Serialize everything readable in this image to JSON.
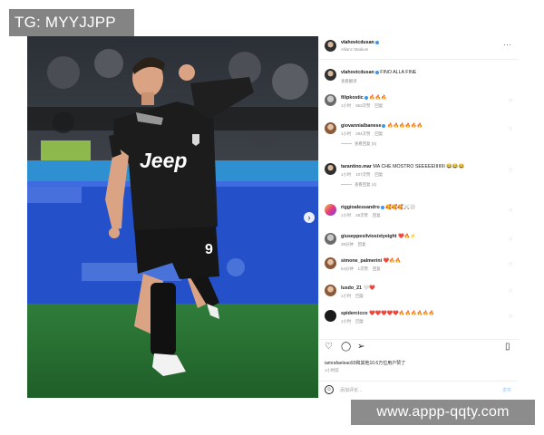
{
  "watermarks": {
    "top": "TG: MYYJJPP",
    "bottom": "www.appp-qqty.com"
  },
  "post": {
    "author": "vlahovicdusan",
    "location": "Allianz Stadium",
    "menu_icon": "more-horizontal-icon",
    "caption": "FINO ALLA FINE",
    "caption_translate": "查看翻译",
    "photo": {
      "shirt_sponsor": "Jeep",
      "shirt_number": "9",
      "next_icon": "chevron-right-icon",
      "tag_icon": "user-tag-icon",
      "slide_count": 5,
      "current_slide": 1
    }
  },
  "comments": [
    {
      "user": "filipkostic",
      "verified": true,
      "text": "🔥🔥🔥",
      "time": "1小时",
      "likes": "653次赞",
      "reply": "回复",
      "thread": ""
    },
    {
      "user": "giovannialbanese",
      "verified": true,
      "text": "🔥🔥🔥🔥🔥🔥",
      "time": "1小时",
      "likes": "284次赞",
      "reply": "回复",
      "thread": "查看回复 (5)"
    },
    {
      "user": "tarantino.mar",
      "verified": false,
      "text": "MA CHE MOSTRO SEEEEEIIIIIIII 😂😂😂",
      "time": "1小时",
      "likes": "107次赞",
      "reply": "回复",
      "thread": "查看回复 (4)"
    },
    {
      "user": "riggioalessandro",
      "verified": true,
      "text": "🥰🥰🥰⚔️⚪",
      "time": "1小时",
      "likes": "28次赞",
      "reply": "回复",
      "thread": ""
    },
    {
      "user": "giuseppesilviosixtyeight",
      "verified": false,
      "text": "❤️🔥⚡",
      "time": "39分钟",
      "likes": "",
      "reply": "回复",
      "thread": ""
    },
    {
      "user": "simone_palmerini",
      "verified": false,
      "text": "❤️🔥🔥",
      "time": "54分钟",
      "likes": "1次赞",
      "reply": "回复",
      "thread": ""
    },
    {
      "user": "lusdo_21",
      "verified": false,
      "text": "🤍❤️",
      "time": "1小时",
      "likes": "",
      "reply": "回复",
      "thread": ""
    },
    {
      "user": "spidercicco",
      "verified": false,
      "text": "❤️❤️❤️❤️❤️🔥🔥🔥🔥🔥🔥",
      "time": "1小时",
      "likes": "",
      "reply": "回复",
      "thread": ""
    }
  ],
  "actions": {
    "like_icon": "heart-icon",
    "comment_icon": "comment-icon",
    "share_icon": "send-icon",
    "save_icon": "bookmark-icon"
  },
  "liked_by": "iamrafaeleao93和其他10.6万位用户赞了",
  "post_time": "1小时前",
  "add_comment": {
    "emoji_icon": "smile-icon",
    "placeholder": "添加评论…",
    "post_label": "发布"
  }
}
